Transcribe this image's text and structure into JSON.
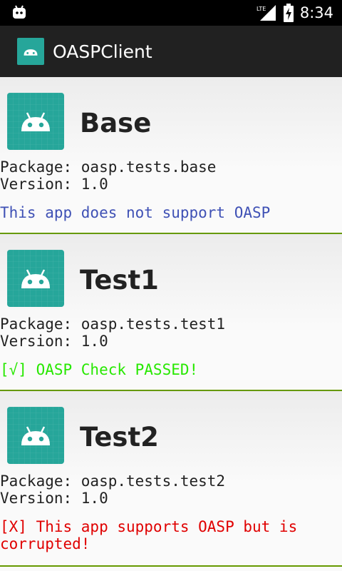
{
  "status_bar": {
    "network": "LTE",
    "time": "8:34",
    "icons": [
      "android-debug-icon",
      "lte-signal-icon",
      "battery-charging-icon"
    ]
  },
  "app_bar": {
    "title": "OASPClient",
    "icon": "android-app-icon"
  },
  "apps": [
    {
      "name": "Base",
      "package_label": "Package: oasp.tests.base",
      "version_label": "Version: 1.0",
      "status_text": "This app does not support OASP",
      "status_color": "#3f51b5"
    },
    {
      "name": "Test1",
      "package_label": "Package: oasp.tests.test1",
      "version_label": "Version: 1.0",
      "status_text": "[√] OASP Check PASSED!",
      "status_color": "#27e800"
    },
    {
      "name": "Test2",
      "package_label": "Package: oasp.tests.test2",
      "version_label": "Version: 1.0",
      "status_text": "[X] This app supports OASP but is corrupted!",
      "status_color": "#e00000"
    }
  ],
  "colors": {
    "divider": "#669900",
    "icon_teal": "#26a69a",
    "app_bar": "#212121"
  }
}
